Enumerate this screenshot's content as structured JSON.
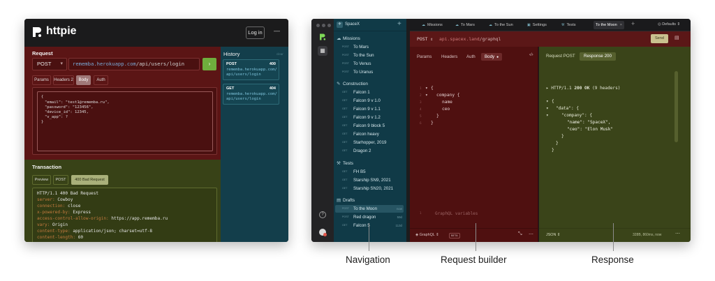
{
  "left_window": {
    "brand": "httpie",
    "login_label": "Log in",
    "menu_glyph": "—",
    "request": {
      "title": "Request",
      "method": "POST",
      "url_host": "rememba.herokuapp.com",
      "url_path": "/api/users/login",
      "send_glyph": "›",
      "tabs": [
        "Params",
        "Headers 2",
        "Body",
        "Auth"
      ],
      "body_lines": [
        "{",
        "\"email\": \"test1@rememba.ru\",",
        "\"password\": \"123456\",",
        "\"device_id\": 12345,",
        "\"v_app\": ?",
        "}"
      ]
    },
    "history": {
      "title": "History",
      "clear_label": "clear",
      "items": [
        {
          "method": "POST",
          "status": "400",
          "url": "rememba.herokuapp.com/api/users/login"
        },
        {
          "method": "GET",
          "status": "404",
          "url": "rememba.herokuapp.com/api/users/login"
        }
      ]
    },
    "transaction": {
      "title": "Transaction",
      "tabs": [
        "Preview",
        "POST",
        "400 Bad Request"
      ],
      "status_line": "HTTP/1.1 400 Bad Request",
      "headers": [
        {
          "k": "server:",
          "v": "Cowboy"
        },
        {
          "k": "connection:",
          "v": "close"
        },
        {
          "k": "x-powered-by:",
          "v": "Express"
        },
        {
          "k": "access-control-allow-origin:",
          "v": "https://app.rememba.ru"
        },
        {
          "k": "vary:",
          "v": "Origin"
        },
        {
          "k": "content-type:",
          "v": "application/json; charset=utf-8"
        },
        {
          "k": "content-length:",
          "v": "60"
        }
      ]
    }
  },
  "right_window": {
    "workspace": "SpaceX",
    "sections": [
      {
        "name": "Missions",
        "icon": "cloud-icon",
        "items": [
          {
            "m": "POST",
            "n": "To Mars"
          },
          {
            "m": "POST",
            "n": "To the Sun"
          },
          {
            "m": "POST",
            "n": "To Venus"
          },
          {
            "m": "POST",
            "n": "To Uranus"
          }
        ]
      },
      {
        "name": "Construction",
        "icon": "wrench-icon",
        "items": [
          {
            "m": "GET",
            "n": "Falcon 1"
          },
          {
            "m": "GET",
            "n": "Falcon 9 v 1.0"
          },
          {
            "m": "GET",
            "n": "Falcon 9 v 1.1"
          },
          {
            "m": "GET",
            "n": "Falcon 9 v 1.2"
          },
          {
            "m": "GET",
            "n": "Falcon 9 block 5"
          },
          {
            "m": "GET",
            "n": "Falcon heavy"
          },
          {
            "m": "GET",
            "n": "Starhopper, 2019"
          },
          {
            "m": "GET",
            "n": "Dragon 2"
          }
        ]
      },
      {
        "name": "Tests",
        "icon": "hammer-icon",
        "items": [
          {
            "m": "GET",
            "n": "FH B5"
          },
          {
            "m": "GET",
            "n": "Starship SN9, 2021"
          },
          {
            "m": "GET",
            "n": "Starship SN20, 2021"
          }
        ]
      },
      {
        "name": "Drafts",
        "icon": "drafts-icon",
        "items": [
          {
            "m": "POST",
            "n": "To the Moon",
            "s": "now"
          },
          {
            "m": "POST",
            "n": "Red dragon",
            "s": "59d"
          },
          {
            "m": "GET",
            "n": "Falcon 5",
            "s": "113d"
          }
        ]
      }
    ],
    "tabs": [
      {
        "label": "Missions",
        "icon": "cloud-icon"
      },
      {
        "label": "To Mars",
        "icon": "cloud-icon"
      },
      {
        "label": "To the Sun",
        "icon": "cloud-icon"
      },
      {
        "label": "Settings",
        "icon": "settings-icon"
      },
      {
        "label": "Tests",
        "icon": "hammer-icon"
      },
      {
        "label": "To the Moon",
        "icon": ""
      }
    ],
    "tab_close": "×",
    "tab_add": "+",
    "defaults_label": "Defaults ⇕",
    "urlbar": {
      "method": "POST ⇕",
      "url_host": "api.spacex.land",
      "url_path": "/graphql",
      "send_label": "Send"
    },
    "builder": {
      "tabs": [
        "Params",
        "Headers",
        "Auth",
        "Body"
      ],
      "code_glyph": "‹/›",
      "query_lines": [
        "{",
        "company {",
        "name",
        "ceo",
        "}",
        "}"
      ],
      "line_numbers": [
        "1",
        "2",
        "3",
        "4",
        "5",
        "6"
      ],
      "vars_line_number": "1",
      "vars_placeholder": "GraphQL variables",
      "footer_mode": "GraphQL ⇕",
      "footer_badge": "BETA"
    },
    "response": {
      "tabs": [
        "Request POST",
        "Response 200"
      ],
      "status_prefix": "HTTP/1.1",
      "status_code": "200 OK",
      "status_suffix": "(9 headers)",
      "json_lines": [
        "{",
        "\"data\": {",
        "\"company\": {",
        "\"name\": \"SpaceX\",",
        "\"ceo\": \"Elon Musk\"",
        "}",
        "}",
        "}"
      ],
      "footer_mode": "JSON ⇕",
      "footer_meta": "328B, 860ms, now"
    }
  },
  "callouts": [
    "Navigation",
    "Request builder",
    "Response"
  ]
}
